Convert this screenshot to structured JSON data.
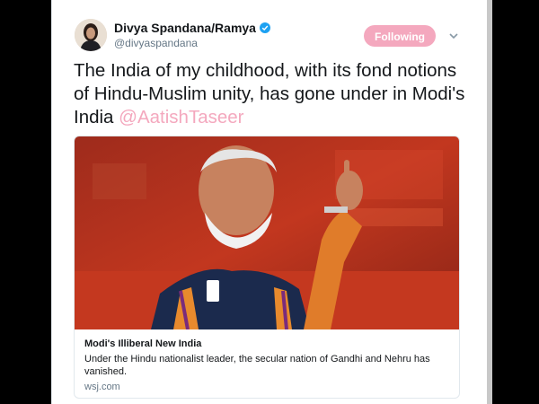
{
  "tweet": {
    "display_name": "Divya Spandana/Ramya",
    "handle": "@divyaspandana",
    "follow_button": "Following",
    "text_before": "The India of my childhood, with its fond notions of Hindu-Muslim unity, has gone under in Modi's India ",
    "mention": "@AatishTaseer",
    "colors": {
      "accent": "#f4a8be",
      "verified": "#1da1f2"
    }
  },
  "card": {
    "title": "Modi's Illiberal New India",
    "description": "Under the Hindu nationalist leader, the secular nation of Gandhi and Nehru has vanished.",
    "domain": "wsj.com"
  },
  "icons": {
    "verified": "verified-badge-icon",
    "caret": "chevron-down-icon"
  }
}
